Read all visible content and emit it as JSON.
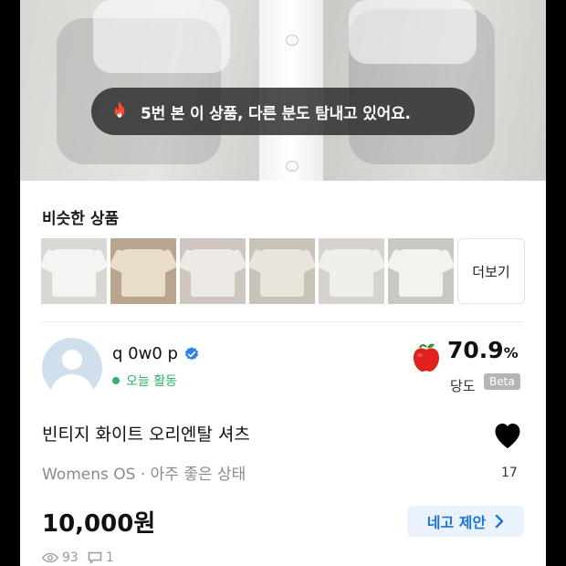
{
  "banner": {
    "message": "5번 본 이 상품, 다른 분도 탐내고 있어요."
  },
  "similar": {
    "title": "비슷한 상품",
    "thumbnails": [
      {
        "alt": "ruffle-white-shirt",
        "color": "#f4f4f2"
      },
      {
        "alt": "beige-blouse",
        "color": "#e8dccb"
      },
      {
        "alt": "white-ruffle-blouse",
        "color": "#efe9e6"
      },
      {
        "alt": "cream-shirt",
        "color": "#e9e4dc"
      },
      {
        "alt": "lace-blouse",
        "color": "#f1efec"
      },
      {
        "alt": "white-tee-blouse",
        "color": "#f3f2ef"
      }
    ],
    "more_label": "더보기"
  },
  "seller": {
    "name": "q 0w0 p",
    "activity": "오늘 활동",
    "score": "70.9",
    "score_unit": "%",
    "score_label": "당도",
    "beta_label": "Beta"
  },
  "product": {
    "title": "빈티지 화이트 오리엔탈 셔츠",
    "subtitle": "Womens OS · 아주 좋은 상태",
    "likes": "17",
    "price": "10,000원",
    "offer_label": "네고 제안",
    "views": "93",
    "comments": "1"
  },
  "colors": {
    "activity_green": "#2bb56a",
    "offer_blue": "#1a73d9",
    "apple_red": "#e0201b"
  }
}
